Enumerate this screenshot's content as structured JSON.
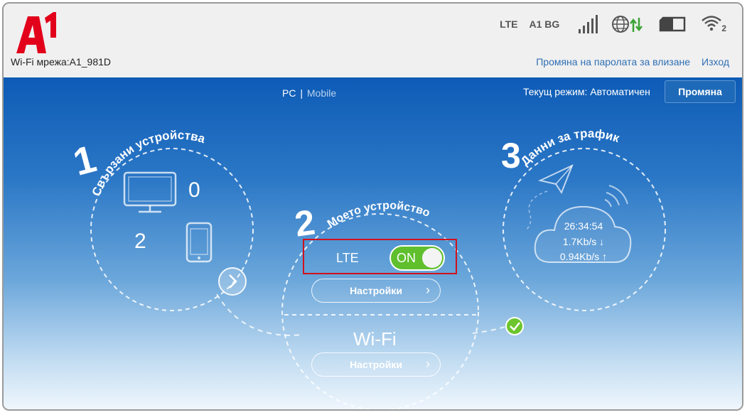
{
  "header": {
    "logo_text": "A1",
    "network_label": "Wi-Fi мрежа:A1_981D",
    "status": {
      "network_type": "LTE",
      "operator": "A1 BG",
      "wifi_clients": "2"
    },
    "links": {
      "change_password": "Промяна на паролата за влизане",
      "logout": "Изход"
    }
  },
  "view_toggle": {
    "pc": "PC",
    "separator": "|",
    "mobile": "Mobile"
  },
  "mode": {
    "label": "Текущ режим: Автоматичен",
    "button": "Промяна"
  },
  "sections": {
    "devices": {
      "number": "1",
      "title": "Свързани устройства",
      "pc_count": "0",
      "mobile_count": "2"
    },
    "my_device": {
      "number": "2",
      "title": "Моето устройство",
      "lte_label": "LTE",
      "lte_state": "ON",
      "lte_settings": "Настройки",
      "wifi_label": "Wi-Fi",
      "wifi_settings": "Настройки"
    },
    "traffic": {
      "number": "3",
      "title": "Данни за трафик",
      "duration": "26:34:54",
      "download": "1.7Kb/s ↓",
      "upload": "0.94Kb/s ↑"
    }
  },
  "colors": {
    "brand_red": "#e2001a",
    "toggle_green": "#5fbf2d",
    "link_blue": "#2f6fb5"
  }
}
